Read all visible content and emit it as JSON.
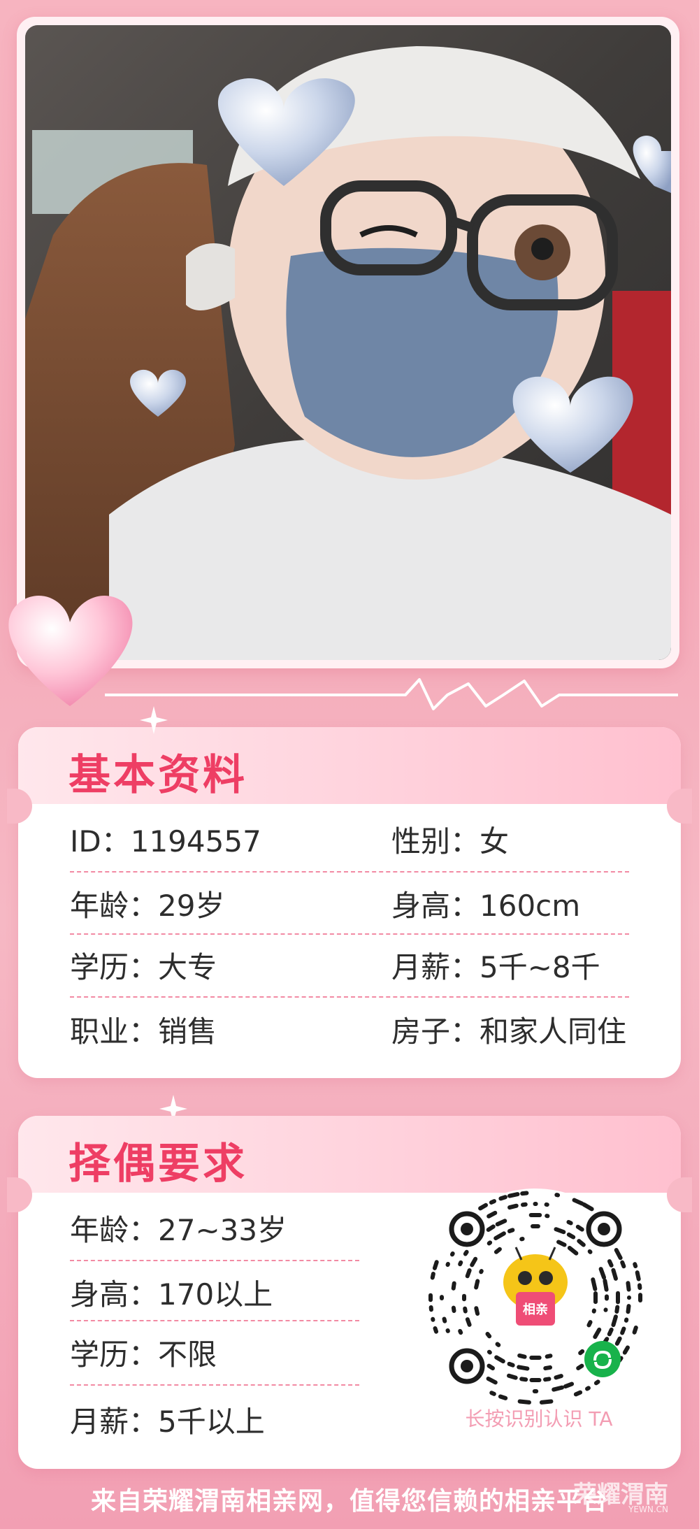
{
  "basic_info": {
    "title": "基本资料",
    "rows": [
      {
        "left_key": "ID：",
        "left_val": "1194557",
        "right_key": "性别：",
        "right_val": "女"
      },
      {
        "left_key": "年龄：",
        "left_val": "29岁",
        "right_key": "身高：",
        "right_val": "160cm"
      },
      {
        "left_key": "学历：",
        "left_val": "大专",
        "right_key": "月薪：",
        "right_val": "5千~8千"
      },
      {
        "left_key": "职业：",
        "left_val": "销售",
        "right_key": "房子：",
        "right_val": "和家人同住"
      }
    ]
  },
  "requirements": {
    "title": "择偶要求",
    "rows": [
      {
        "key": "年龄：",
        "val": "27~33岁"
      },
      {
        "key": "身高：",
        "val": "170以上"
      },
      {
        "key": "学历：",
        "val": "不限"
      },
      {
        "key": "月薪：",
        "val": "5千以上"
      }
    ],
    "qr_caption": "长按识别认识 TA",
    "qr_badge": "相亲"
  },
  "footer": {
    "text": "来自荣耀渭南相亲网，值得您信赖的相亲平台",
    "watermark": "荣耀渭南",
    "watermark_sub": "YEWN.CN"
  },
  "colors": {
    "accent": "#ee3e64",
    "background": "#f6b3c1",
    "dash": "#f28aa3"
  }
}
